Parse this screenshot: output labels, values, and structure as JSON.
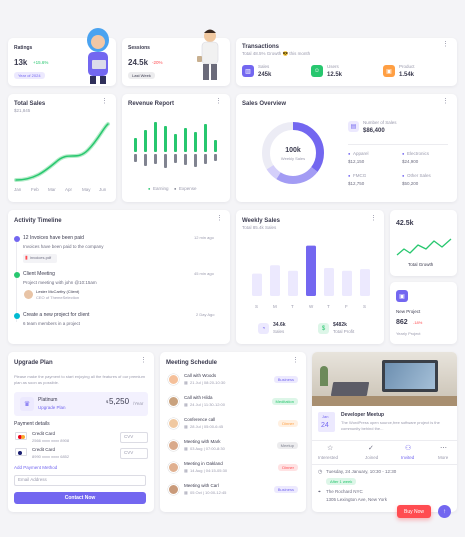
{
  "ratings": {
    "title": "Ratings",
    "value": "13k",
    "change": "+15.6%",
    "badge": "Year of 2024"
  },
  "sessions": {
    "title": "Sessions",
    "value": "24.5k",
    "change": "-20%",
    "badge": "Last Week"
  },
  "transactions": {
    "title": "Transactions",
    "subtitle": "Total 48.5% Growth 😎 this month",
    "stats": [
      {
        "label": "Sales",
        "value": "245k",
        "color": "#7367f0",
        "icon": "chart-icon"
      },
      {
        "label": "Users",
        "value": "12.5k",
        "color": "#28c76f",
        "icon": "users-icon"
      },
      {
        "label": "Product",
        "value": "1.54k",
        "color": "#ff9f43",
        "icon": "box-icon"
      }
    ]
  },
  "total_sales": {
    "title": "Total Sales",
    "value": "$21,845",
    "months": [
      "Jan",
      "Feb",
      "Mar",
      "Apr",
      "May",
      "Jun"
    ]
  },
  "revenue_report": {
    "title": "Revenue Report",
    "legend_earning": "Earning",
    "legend_expense": "Expense"
  },
  "sales_overview": {
    "title": "Sales Overview",
    "donut_value": "100k",
    "donut_label": "Weekly Sales",
    "orders_label": "Number of Sales",
    "orders_value": "$86,400",
    "items": [
      {
        "label": "Apparel",
        "value": "$12,150",
        "color": "#7367f0"
      },
      {
        "label": "Electronics",
        "value": "$24,900",
        "color": "#7367f0"
      },
      {
        "label": "FMCG",
        "value": "$12,750",
        "color": "#7367f0"
      },
      {
        "label": "Other Sales",
        "value": "$50,200",
        "color": "#7367f0"
      }
    ]
  },
  "activity": {
    "title": "Activity Timeline",
    "items": [
      {
        "title": "12 Invoices have been paid",
        "time": "12 min ago",
        "desc": "Invoices have been paid to the company",
        "extra": "invoices.pdf",
        "color": "#7367f0"
      },
      {
        "title": "Client Meeting",
        "time": "45 min ago",
        "desc": "Project meeting with john @10:15am",
        "extra_name": "Lester McCarthy (Client)",
        "extra_role": "CEO of ThemeSelection",
        "color": "#28c76f"
      },
      {
        "title": "Create a new project for client",
        "time": "2 Day Ago",
        "desc": "6 team members in a project",
        "color": "#00bad1"
      }
    ]
  },
  "weekly_sales": {
    "title": "Weekly Sales",
    "subtitle": "Total 85.4k Sales",
    "days": [
      "S",
      "M",
      "T",
      "W",
      "T",
      "F",
      "S"
    ],
    "values": [
      40,
      55,
      45,
      90,
      50,
      45,
      48
    ],
    "sales_value": "34.6k",
    "sales_label": "Sales",
    "profit_value": "$482k",
    "profit_label": "Total Profit"
  },
  "total_growth": {
    "value": "42.5k",
    "label": "Total Growth"
  },
  "new_project": {
    "title": "New Project",
    "value": "862",
    "change": "-18%",
    "label": "Yearly Project"
  },
  "upgrade": {
    "title": "Upgrade Plan",
    "desc": "Please make the payment to start enjoying all the features of our premium plan as soon as possible.",
    "plan_name": "Platinum",
    "plan_link": "Upgrade Plan",
    "price": "5,250",
    "currency": "$",
    "period": "/Year",
    "payment_title": "Payment details",
    "cards": [
      {
        "name": "Credit Card",
        "number": "2566 xxxx xxxx 8908",
        "cvv": "CVV"
      },
      {
        "name": "Credit Card",
        "number": "8990 xxxx xxxx 6852",
        "cvv": "CVV"
      }
    ],
    "add_link": "Add Payment Method",
    "email_placeholder": "Email Address",
    "button": "Contact Now"
  },
  "meetings": {
    "title": "Meeting Schedule",
    "items": [
      {
        "name": "Call with Woods",
        "date": "21 Jul | 08:20-10:30",
        "tag": "Business",
        "tag_color": "#7367f0",
        "tag_bg": "#ece9fe",
        "avatar": "#f5c09a"
      },
      {
        "name": "Call with Hilda",
        "date": "24 Jul | 11:30-12:00",
        "tag": "Meditation",
        "tag_color": "#28c76f",
        "tag_bg": "#ddf6e8",
        "avatar": "#c9a27e"
      },
      {
        "name": "Conference call",
        "date": "28 Jul | 05:00-6:45",
        "tag": "Dinner",
        "tag_color": "#ff9f43",
        "tag_bg": "#fff0e1",
        "avatar": "#f0c8a0"
      },
      {
        "name": "Meeting with Mark",
        "date": "03 Aug | 07:00-8:30",
        "tag": "Meetup",
        "tag_color": "#808390",
        "tag_bg": "#ececee",
        "avatar": "#d9a98a"
      },
      {
        "name": "Meeting in Oakland",
        "date": "14 Aug | 04:15-05:30",
        "tag": "Dinner",
        "tag_color": "#ff4c51",
        "tag_bg": "#ffe2e3",
        "avatar": "#e0b090"
      },
      {
        "name": "Meeting with Carl",
        "date": "05 Oct | 10:00-12:45",
        "tag": "Business",
        "tag_color": "#7367f0",
        "tag_bg": "#ece9fe",
        "avatar": "#c99a7a"
      }
    ]
  },
  "event": {
    "month": "Jan",
    "day": "24",
    "title": "Developer Meetup",
    "desc": "The WordPress open source,free software project is the community behind the...",
    "actions": [
      {
        "label": "Interested",
        "icon": "star-icon"
      },
      {
        "label": "Joined",
        "icon": "check-icon"
      },
      {
        "label": "Invited",
        "icon": "users-icon"
      },
      {
        "label": "More",
        "icon": "more-icon"
      }
    ],
    "datetime": "Tuesday, 24 January, 10:30 - 12:30",
    "relative": "After 1 week",
    "venue": "The Rochard NYC",
    "address": "1305 Lexington Ave, New York"
  },
  "buy_now": "Buy Now",
  "colors": {
    "primary": "#7367f0",
    "success": "#28c76f",
    "warning": "#ff9f43",
    "danger": "#ff4c51",
    "info": "#00bad1"
  }
}
